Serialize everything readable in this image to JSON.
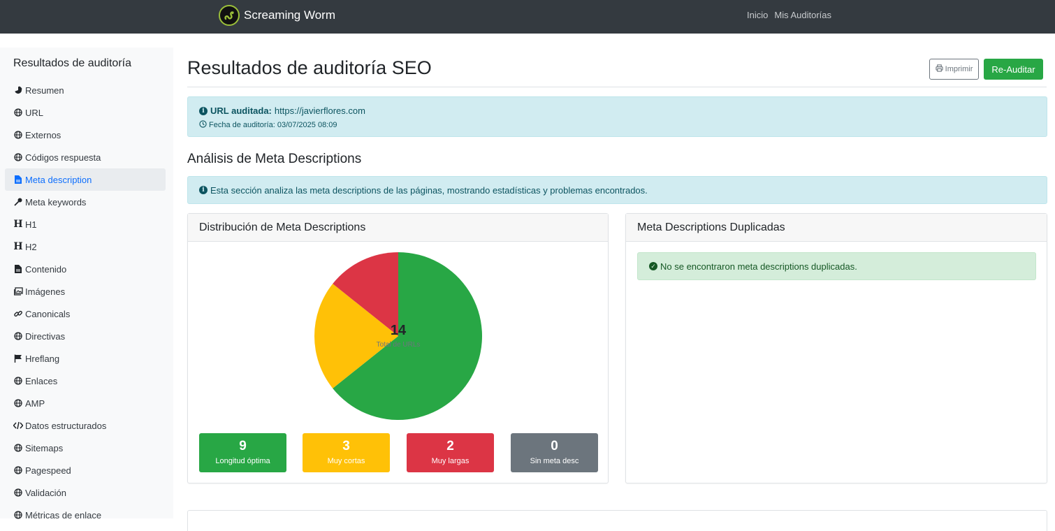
{
  "navbar": {
    "brand": "Screaming Worm",
    "links": [
      "Inicio",
      "Mis Auditorías"
    ]
  },
  "sidebar": {
    "title": "Resultados de auditoría",
    "items": [
      {
        "label": "Resumen",
        "icon": "pie-chart-icon"
      },
      {
        "label": "URL",
        "icon": "globe-icon"
      },
      {
        "label": "Externos",
        "icon": "globe-icon"
      },
      {
        "label": "Códigos respuesta",
        "icon": "globe-icon"
      },
      {
        "label": "Meta description",
        "icon": "file-icon",
        "active": true
      },
      {
        "label": "Meta keywords",
        "icon": "key-icon"
      },
      {
        "label": "H1",
        "icon": "heading-icon"
      },
      {
        "label": "H2",
        "icon": "heading-icon"
      },
      {
        "label": "Contenido",
        "icon": "file-icon"
      },
      {
        "label": "Imágenes",
        "icon": "images-icon"
      },
      {
        "label": "Canonicals",
        "icon": "link-icon"
      },
      {
        "label": "Directivas",
        "icon": "globe-icon"
      },
      {
        "label": "Hreflang",
        "icon": "flag-icon"
      },
      {
        "label": "Enlaces",
        "icon": "globe-icon"
      },
      {
        "label": "AMP",
        "icon": "globe-icon"
      },
      {
        "label": "Datos estructurados",
        "icon": "code-icon"
      },
      {
        "label": "Sitemaps",
        "icon": "globe-icon"
      },
      {
        "label": "Pagespeed",
        "icon": "globe-icon"
      },
      {
        "label": "Validación",
        "icon": "globe-icon"
      },
      {
        "label": "Métricas de enlace",
        "icon": "globe-icon"
      }
    ]
  },
  "header": {
    "title": "Resultados de auditoría SEO",
    "print_label": "Imprimir",
    "reaudit_label": "Re-Auditar"
  },
  "audit_info": {
    "url_label": "URL auditada:",
    "url": "https://javierflores.com",
    "date_text": "Fecha de auditoría: 03/07/2025 08:09"
  },
  "section": {
    "title": "Análisis de Meta Descriptions",
    "info": "Esta sección analiza las meta descriptions de las páginas, mostrando estadísticas y problemas encontrados."
  },
  "distribution": {
    "title": "Distribución de Meta Descriptions",
    "total": "14",
    "total_label": "Total de URLs"
  },
  "chart_data": {
    "type": "pie",
    "categories": [
      "Longitud óptima",
      "Muy cortas",
      "Muy largas",
      "Sin meta desc"
    ],
    "values": [
      9,
      3,
      2,
      0
    ],
    "colors": [
      "#28a745",
      "#ffc107",
      "#dc3545",
      "#6c757d"
    ]
  },
  "stats": [
    {
      "value": "9",
      "label": "Longitud óptima",
      "color": "#28a745"
    },
    {
      "value": "3",
      "label": "Muy cortas",
      "color": "#ffc107"
    },
    {
      "value": "2",
      "label": "Muy largas",
      "color": "#dc3545"
    },
    {
      "value": "0",
      "label": "Sin meta desc",
      "color": "#6c757d"
    }
  ],
  "duplicates": {
    "title": "Meta Descriptions Duplicadas",
    "message": "No se encontraron meta descriptions duplicadas."
  }
}
